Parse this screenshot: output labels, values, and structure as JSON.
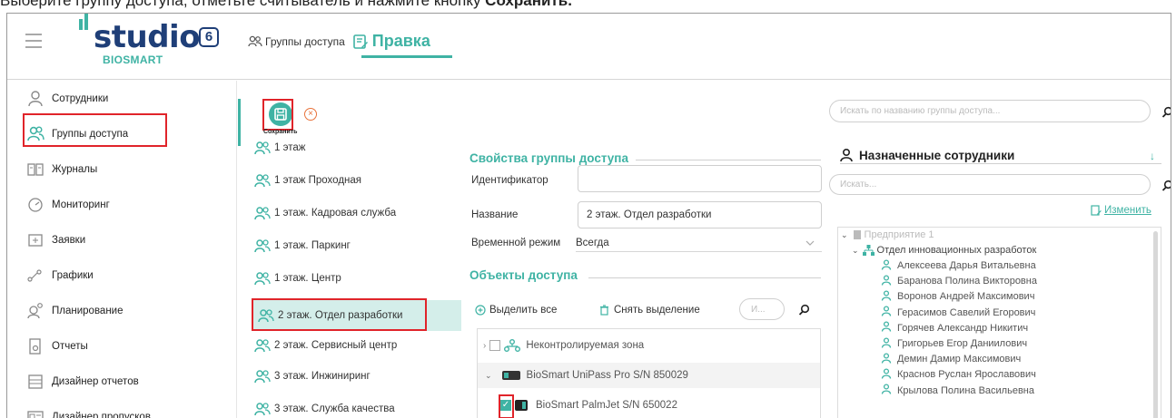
{
  "instruction": {
    "text": "Выберите группу доступа, отметьте считыватель и нажмите кнопку ",
    "bold": "Сохранить."
  },
  "header": {
    "logo_text": "studio",
    "logo_number": "6",
    "logo_sub": "BIOSMART",
    "tab_access": "Группы доступа",
    "tab_edit": "Правка"
  },
  "sidebar": {
    "items": [
      {
        "label": "Сотрудники",
        "icon": "person-icon"
      },
      {
        "label": "Группы доступа",
        "icon": "group-icon"
      },
      {
        "label": "Журналы",
        "icon": "journal-icon"
      },
      {
        "label": "Мониторинг",
        "icon": "monitor-icon"
      },
      {
        "label": "Заявки",
        "icon": "request-icon"
      },
      {
        "label": "Графики",
        "icon": "schedule-icon"
      },
      {
        "label": "Планирование",
        "icon": "planning-icon"
      },
      {
        "label": "Отчеты",
        "icon": "report-icon"
      },
      {
        "label": "Дизайнер отчетов",
        "icon": "report-designer-icon"
      },
      {
        "label": "Дизайнер пропусков",
        "icon": "pass-designer-icon"
      }
    ]
  },
  "toolbar": {
    "save_label": "Сохранить"
  },
  "groups": [
    "1 этаж",
    "1 этаж Проходная",
    "1 этаж. Кадровая служба",
    "1 этаж. Паркинг",
    "1 этаж. Центр",
    "2 этаж. Отдел разработки",
    "2 этаж. Сервисный центр",
    "3 этаж. Инжиниринг",
    "3 этаж. Служба качества"
  ],
  "properties": {
    "title": "Свойства группы доступа",
    "id_label": "Идентификатор",
    "id_value": "",
    "name_label": "Название",
    "name_value": "2 этаж. Отдел разработки",
    "mode_label": "Временной режим",
    "mode_value": "Всегда"
  },
  "objects": {
    "title": "Объекты доступа",
    "select_all": "Выделить все",
    "deselect": "Снять выделение",
    "search_placeholder": "И...",
    "tree": [
      "Неконтролируемая зона",
      "BioSmart UniPass Pro S/N 850029",
      "BioSmart PalmJet S/N 650022"
    ]
  },
  "right": {
    "top_search_placeholder": "Искать по названию группы доступа...",
    "assigned_title": "Назначенные сотрудники",
    "assigned_search_placeholder": "Искать...",
    "change_link": "Изменить",
    "org": "Предприятие 1",
    "department": "Отдел инновационных разработок",
    "staff": [
      "Алексеева Дарья Витальевна",
      "Баранова Полина Викторовна",
      "Воронов Андрей Максимович",
      "Герасимов Савелий Егорович",
      "Горячев Александр Никитич",
      "Григорьев Егор Даниилович",
      "Демин Дамир Максимович",
      "Краснов Руслан Ярославович",
      "Крылова Полина Васильевна"
    ]
  },
  "colors": {
    "accent": "#3fb3a4",
    "brand_dark": "#1f3f78",
    "highlight": "#e0242a",
    "cancel": "#e8723a"
  }
}
